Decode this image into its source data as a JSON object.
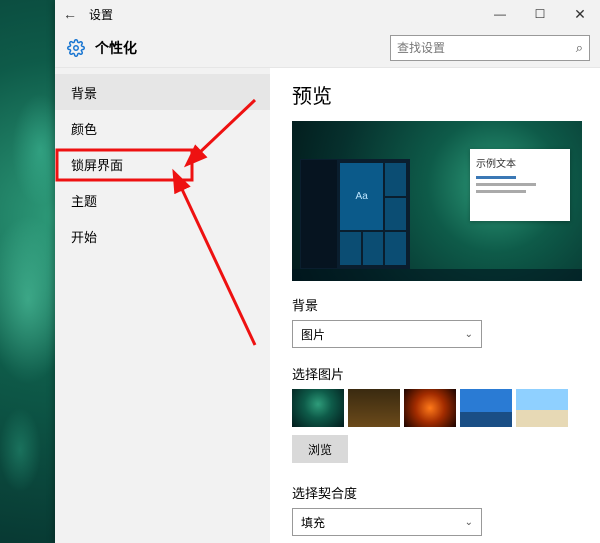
{
  "window": {
    "back_glyph": "←",
    "title": "设置",
    "minimize": "—",
    "maximize": "☐",
    "close": "✕"
  },
  "header": {
    "title": "个性化",
    "search_placeholder": "查找设置",
    "search_glyph": "⌕"
  },
  "sidebar": {
    "items": [
      {
        "label": "背景",
        "active": true
      },
      {
        "label": "颜色",
        "active": false
      },
      {
        "label": "锁屏界面",
        "active": false
      },
      {
        "label": "主题",
        "active": false
      },
      {
        "label": "开始",
        "active": false
      }
    ]
  },
  "content": {
    "preview_heading": "预览",
    "preview_sample_text": "示例文本",
    "preview_tile_text": "Aa",
    "background_label": "背景",
    "background_value": "图片",
    "choose_picture_label": "选择图片",
    "browse_label": "浏览",
    "fit_label": "选择契合度",
    "fit_value": "填充",
    "chevron": "⌄"
  },
  "annotation": {
    "highlighted_item_index": 3
  }
}
